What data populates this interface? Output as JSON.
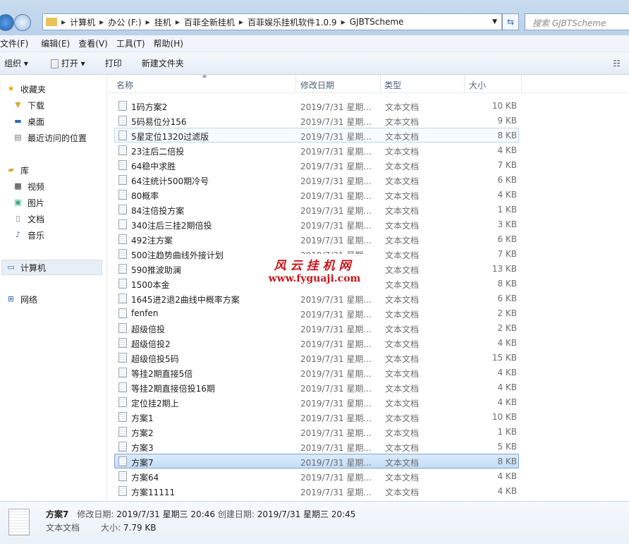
{
  "address": {
    "crumbs": [
      "计算机",
      "办公 (F:)",
      "挂机",
      "百菲全新挂机",
      "百菲娱乐挂机软件1.0.9",
      "GJBTScheme"
    ],
    "search_placeholder": "搜索 GJBTScheme"
  },
  "menu": [
    "文件(F)",
    "编辑(E)",
    "查看(V)",
    "工具(T)",
    "帮助(H)"
  ],
  "toolbar": {
    "organize": "组织 ▾",
    "open": "打开 ▾",
    "print": "打印",
    "new_folder": "新建文件夹"
  },
  "sidebar": {
    "favorites": "收藏夹",
    "downloads": "下载",
    "desktop": "桌面",
    "recent": "最近访问的位置",
    "libraries": "库",
    "videos": "视频",
    "pictures": "图片",
    "documents": "文档",
    "music": "音乐",
    "computer": "计算机",
    "network": "网络"
  },
  "columns": {
    "name": "名称",
    "date": "修改日期",
    "type": "类型",
    "size": "大小"
  },
  "files": [
    {
      "name": "1码方案2",
      "date": "2019/7/31 星期...",
      "type": "文本文档",
      "size": "10 KB"
    },
    {
      "name": "5码易位分156",
      "date": "2019/7/31 星期...",
      "type": "文本文档",
      "size": "9 KB"
    },
    {
      "name": "5星定位1320过滤版",
      "date": "2019/7/31 星期...",
      "type": "文本文档",
      "size": "8 KB"
    },
    {
      "name": "23注后二倍投",
      "date": "2019/7/31 星期...",
      "type": "文本文档",
      "size": "4 KB"
    },
    {
      "name": "64稳中求胜",
      "date": "2019/7/31 星期...",
      "type": "文本文档",
      "size": "7 KB"
    },
    {
      "name": "64注统计500期冷号",
      "date": "2019/7/31 星期...",
      "type": "文本文档",
      "size": "6 KB"
    },
    {
      "name": "80概率",
      "date": "2019/7/31 星期...",
      "type": "文本文档",
      "size": "4 KB"
    },
    {
      "name": "84注倍投方案",
      "date": "2019/7/31 星期...",
      "type": "文本文档",
      "size": "1 KB"
    },
    {
      "name": "340注后三挂2期倍投",
      "date": "2019/7/31 星期...",
      "type": "文本文档",
      "size": "3 KB"
    },
    {
      "name": "492注方案",
      "date": "2019/7/31 星期...",
      "type": "文本文档",
      "size": "6 KB"
    },
    {
      "name": "500注趋势曲线外接计划",
      "date": "2019/7/31 星期...",
      "type": "文本文档",
      "size": "7 KB"
    },
    {
      "name": "590推波助澜",
      "date": "2019/7/31 星期...",
      "type": "文本文档",
      "size": "13 KB"
    },
    {
      "name": "1500本金",
      "date": "2019/7/31 星期...",
      "type": "文本文档",
      "size": "8 KB"
    },
    {
      "name": "1645进2退2曲线中概率方案",
      "date": "2019/7/31 星期...",
      "type": "文本文档",
      "size": "6 KB"
    },
    {
      "name": "fenfen",
      "date": "2019/7/31 星期...",
      "type": "文本文档",
      "size": "2 KB"
    },
    {
      "name": "超级倍投",
      "date": "2019/7/31 星期...",
      "type": "文本文档",
      "size": "2 KB"
    },
    {
      "name": "超级倍投2",
      "date": "2019/7/31 星期...",
      "type": "文本文档",
      "size": "4 KB"
    },
    {
      "name": "超级倍投5码",
      "date": "2019/7/31 星期...",
      "type": "文本文档",
      "size": "15 KB"
    },
    {
      "name": "等挂2期直接5倍",
      "date": "2019/7/31 星期...",
      "type": "文本文档",
      "size": "4 KB"
    },
    {
      "name": "等挂2期直接倍投16期",
      "date": "2019/7/31 星期...",
      "type": "文本文档",
      "size": "4 KB"
    },
    {
      "name": "定位挂2期上",
      "date": "2019/7/31 星期...",
      "type": "文本文档",
      "size": "4 KB"
    },
    {
      "name": "方案1",
      "date": "2019/7/31 星期...",
      "type": "文本文档",
      "size": "10 KB"
    },
    {
      "name": "方案2",
      "date": "2019/7/31 星期...",
      "type": "文本文档",
      "size": "1 KB"
    },
    {
      "name": "方案3",
      "date": "2019/7/31 星期...",
      "type": "文本文档",
      "size": "5 KB"
    },
    {
      "name": "方案7",
      "date": "2019/7/31 星期...",
      "type": "文本文档",
      "size": "8 KB"
    },
    {
      "name": "方案64",
      "date": "2019/7/31 星期...",
      "type": "文本文档",
      "size": "4 KB"
    },
    {
      "name": "方案11111",
      "date": "2019/7/31 星期...",
      "type": "文本文档",
      "size": "4 KB"
    }
  ],
  "watermark": {
    "line1": "风云挂机网",
    "line2": "www.fyguaji.com"
  },
  "details": {
    "name": "方案7",
    "modified_label": "修改日期:",
    "modified": "2019/7/31 星期三 20:46",
    "created_label": "创建日期:",
    "created": "2019/7/31 星期三 20:45",
    "type": "文本文档",
    "size_label": "大小:",
    "size": "7.79 KB"
  }
}
